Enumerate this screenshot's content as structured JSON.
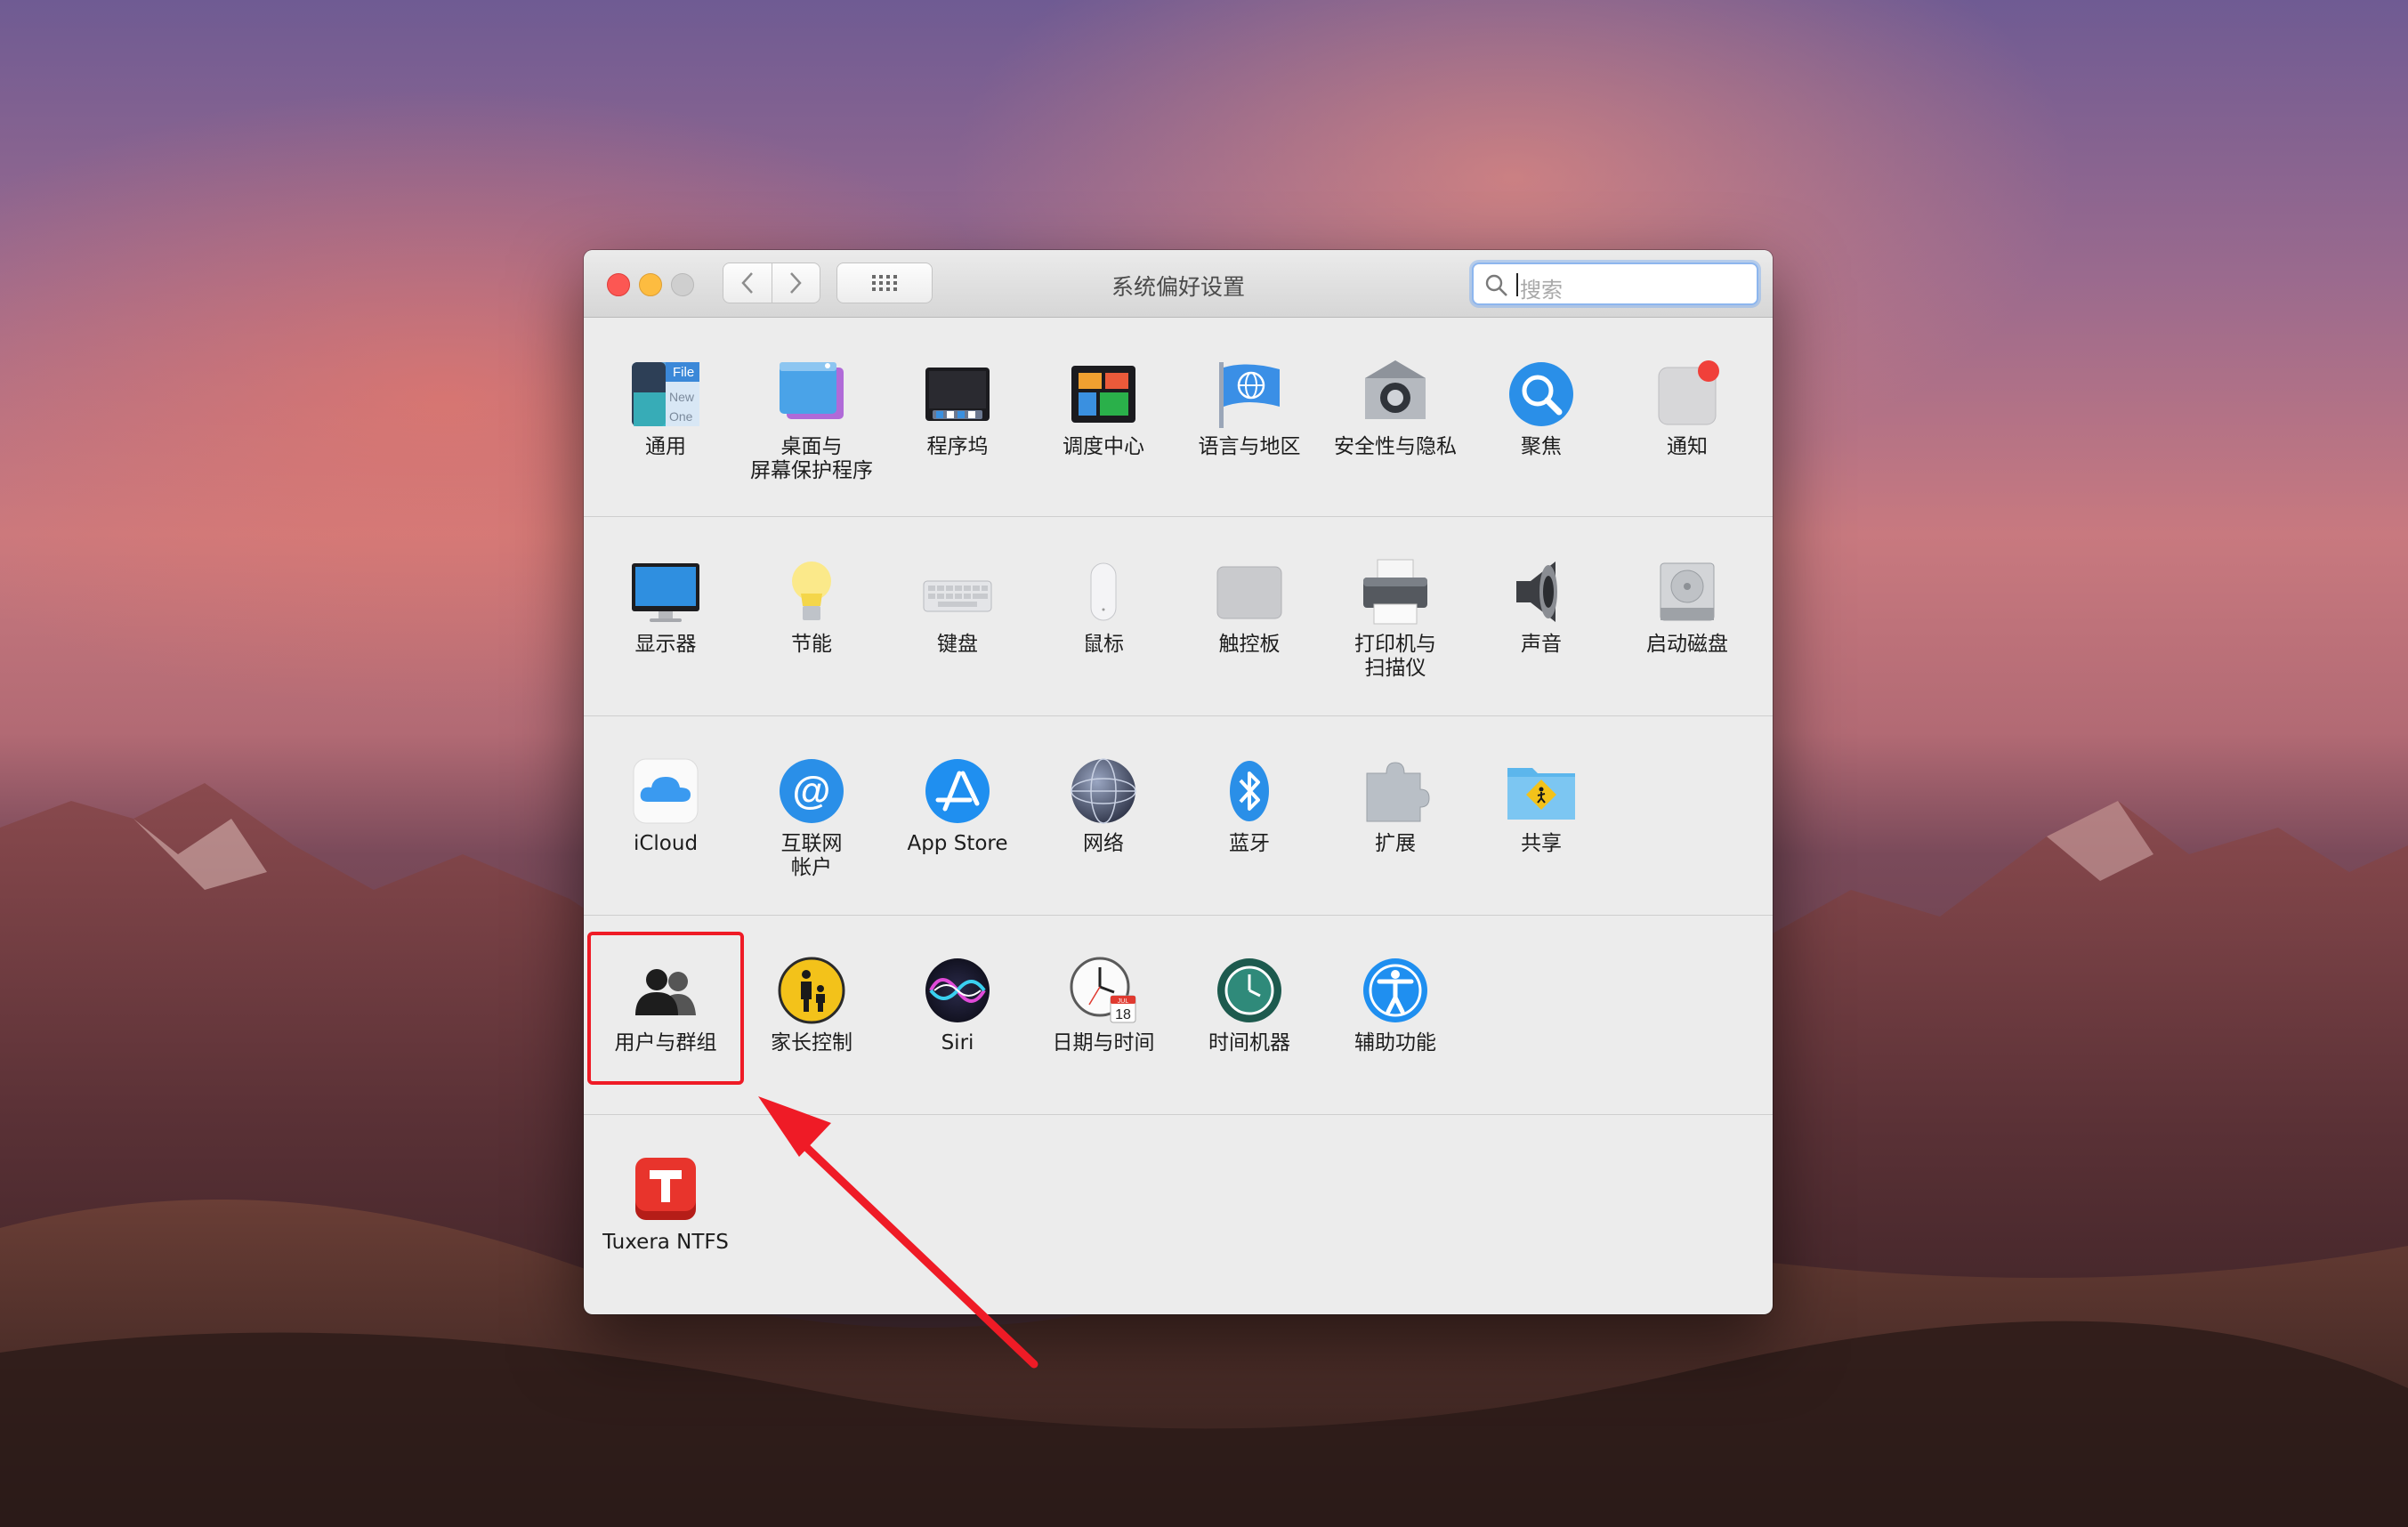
{
  "window": {
    "title": "系统偏好设置",
    "search_placeholder": "搜索",
    "nav": {
      "back_icon": "chevron-left-icon",
      "forward_icon": "chevron-right-icon",
      "grid_icon": "grid-icon"
    }
  },
  "sections": [
    {
      "items": [
        {
          "label": "通用",
          "icon": "general-icon"
        },
        {
          "label": "桌面与\n屏幕保护程序",
          "icon": "desktop-screensaver-icon"
        },
        {
          "label": "程序坞",
          "icon": "dock-icon"
        },
        {
          "label": "调度中心",
          "icon": "mission-control-icon"
        },
        {
          "label": "语言与地区",
          "icon": "language-region-icon"
        },
        {
          "label": "安全性与隐私",
          "icon": "security-privacy-icon"
        },
        {
          "label": "聚焦",
          "icon": "spotlight-icon"
        },
        {
          "label": "通知",
          "icon": "notifications-icon"
        }
      ]
    },
    {
      "items": [
        {
          "label": "显示器",
          "icon": "displays-icon"
        },
        {
          "label": "节能",
          "icon": "energy-saver-icon"
        },
        {
          "label": "键盘",
          "icon": "keyboard-icon"
        },
        {
          "label": "鼠标",
          "icon": "mouse-icon"
        },
        {
          "label": "触控板",
          "icon": "trackpad-icon"
        },
        {
          "label": "打印机与\n扫描仪",
          "icon": "printers-scanners-icon"
        },
        {
          "label": "声音",
          "icon": "sound-icon"
        },
        {
          "label": "启动磁盘",
          "icon": "startup-disk-icon"
        }
      ]
    },
    {
      "items": [
        {
          "label": "iCloud",
          "icon": "icloud-icon"
        },
        {
          "label": "互联网\n帐户",
          "icon": "internet-accounts-icon"
        },
        {
          "label": "App Store",
          "icon": "app-store-icon"
        },
        {
          "label": "网络",
          "icon": "network-icon"
        },
        {
          "label": "蓝牙",
          "icon": "bluetooth-icon"
        },
        {
          "label": "扩展",
          "icon": "extensions-icon"
        },
        {
          "label": "共享",
          "icon": "sharing-icon"
        }
      ]
    },
    {
      "items": [
        {
          "label": "用户与群组",
          "icon": "users-groups-icon"
        },
        {
          "label": "家长控制",
          "icon": "parental-controls-icon"
        },
        {
          "label": "Siri",
          "icon": "siri-icon"
        },
        {
          "label": "日期与时间",
          "icon": "date-time-icon"
        },
        {
          "label": "时间机器",
          "icon": "time-machine-icon"
        },
        {
          "label": "辅助功能",
          "icon": "accessibility-icon"
        }
      ]
    },
    {
      "items": [
        {
          "label": "Tuxera NTFS",
          "icon": "tuxera-ntfs-icon"
        }
      ]
    }
  ],
  "icon_text": {
    "general_file": "File",
    "general_new": "New",
    "general_one": "One",
    "calendar_month": "JUL",
    "calendar_day": "18"
  },
  "annotation": {
    "highlight_color": "#ef1b26",
    "highlighted_item": "用户与群组"
  }
}
